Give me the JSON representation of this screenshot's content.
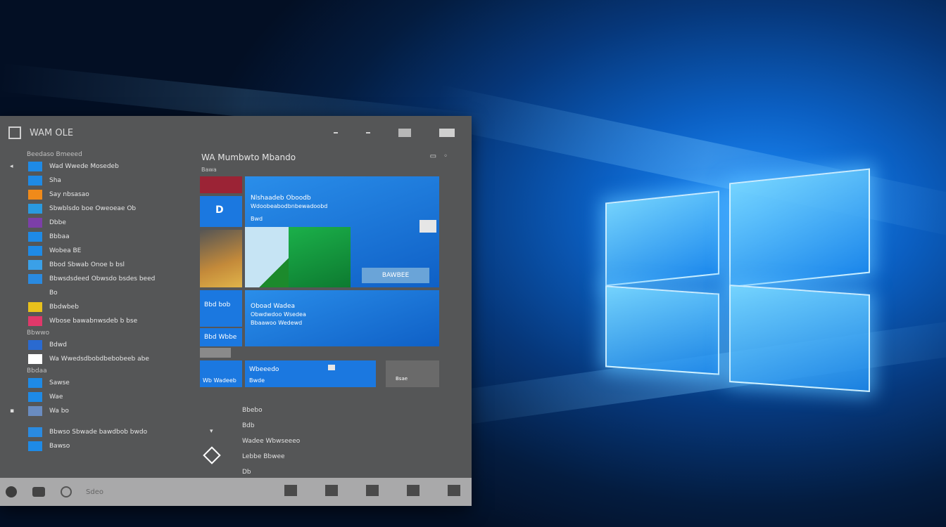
{
  "start_menu": {
    "title": "WAM OLE",
    "tiles_heading": "WA Mumbwto Mbando",
    "tiles_subheading": "Bawa",
    "sections": [
      "Beedaso Bmeeed",
      "Bbwwo",
      "Bbdaa"
    ],
    "apps": [
      {
        "label": "Wad Wwede Mosedeb",
        "color": "#1e8ae6",
        "marker": "◂"
      },
      {
        "label": "Sha",
        "color": "#1e8ae6"
      },
      {
        "label": "Say nbsasao",
        "color": "#f08a1a"
      },
      {
        "label": "Sbwblsdo boe Oweoeae Ob",
        "color": "#2a9ae0"
      },
      {
        "label": "Dbbe",
        "color": "#7c3fa8"
      },
      {
        "label": "Bbbaa",
        "color": "#1e8ae6"
      },
      {
        "label": "Wobea BE",
        "color": "#1e8ae6"
      },
      {
        "label": "Bbod Sbwab Onoe b bsl",
        "color": "#3aa0e8"
      },
      {
        "label": "Bbwsdsdeed Obwsdo bsdes beed",
        "color": "#2a8ae0"
      },
      {
        "label": "Bo",
        "color": "#555657",
        "marker": ""
      },
      {
        "label": "Bbdwbeb",
        "color": "#e8c11c"
      },
      {
        "label": "Wbose bawabnwsdeb b bse",
        "color": "#e0386a"
      },
      {
        "label": "Bdwd",
        "color": "#2a6ad0"
      },
      {
        "label": "Wa Wwedsdbobdbebobeeb abe",
        "color": "#ffffff"
      },
      {
        "label": "Sawse",
        "color": "#1e8ae6"
      },
      {
        "label": "Wae",
        "color": "#1e8ae6"
      },
      {
        "label": "Wa bo",
        "color": "#6a8cc0",
        "marker": "▪"
      },
      {
        "label": "Bbwso Sbwade bawdbob bwdo",
        "color": "#2a8ae0"
      },
      {
        "label": "Bawso",
        "color": "#1e8ae6"
      }
    ],
    "tiles": {
      "t1": "Nlshaadeb Oboodb",
      "t1b": "Wdoobeabodbnbewadoobd",
      "t1c": "Bwd",
      "t2": "Oboad Wadea",
      "t2b": "Obwdwdoo Wsedea",
      "t2c": "Bbaawoo Wedewd",
      "t2d": "Bbd bob",
      "t2e": "Bbd Wbbe",
      "t3": "Wbeeedo",
      "t3b": "Bwde",
      "t4": "Wb Wadeeb",
      "t5": "Bsae",
      "wide_bar": "BAWBEE"
    },
    "lower_list": [
      "Bbebo",
      "Bdb",
      "Wadee Wbwseeeo",
      "Lebbe Bbwee",
      "Db"
    ]
  },
  "taskbar": {
    "search_text": "Sdeo"
  }
}
